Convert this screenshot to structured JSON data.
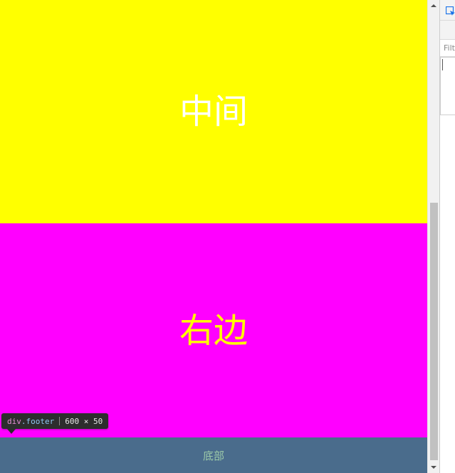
{
  "page": {
    "middle_block": {
      "text": "中间",
      "background": "#ffff00",
      "text_color": "#ffffff"
    },
    "right_block": {
      "text": "右边",
      "background": "#ff00ff",
      "text_color": "#ffff00"
    },
    "footer": {
      "text": "底部",
      "background": "#4a6c8c",
      "text_color": "#9cc9a9"
    }
  },
  "inspector_tooltip": {
    "tag": "div",
    "class": ".footer",
    "dimensions": "600 × 50"
  },
  "scrollbar": {
    "up_icon": "arrow-up-icon",
    "down_icon": "arrow-down-icon"
  },
  "devtools": {
    "filter_placeholder": "Filt",
    "select_icon": "select-element-icon",
    "record_icon": "record-icon",
    "record_color": "#d81b1b"
  }
}
